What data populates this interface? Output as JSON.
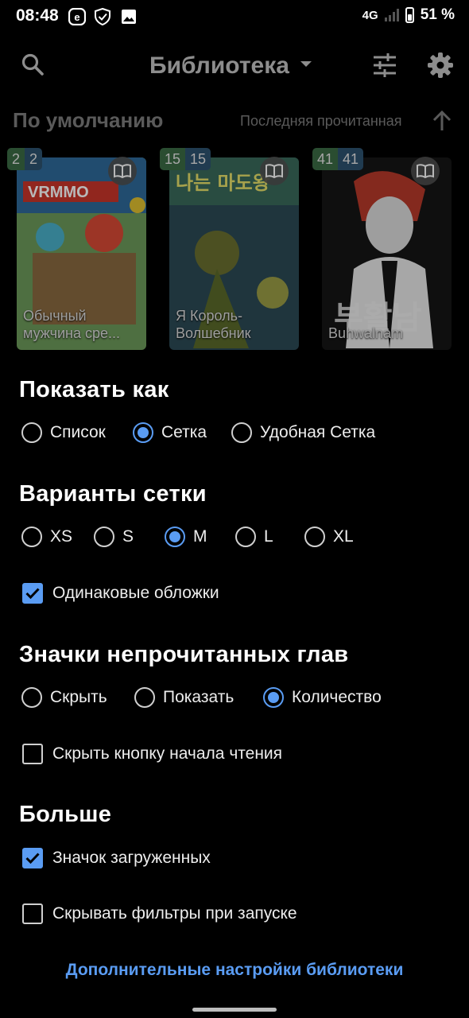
{
  "status_bar": {
    "time": "08:48",
    "network": "4G",
    "battery": "51 %"
  },
  "toolbar": {
    "title": "Библиотека"
  },
  "sort": {
    "group": "По умолчанию",
    "mode": "Последняя прочитанная"
  },
  "library": [
    {
      "title": "Обычный мужчина сре...",
      "unread": "2",
      "downloaded": "2",
      "colors": [
        "#4a7a4a",
        "#c94a3a",
        "#d9b030"
      ]
    },
    {
      "title": "Я Король-Волшебник",
      "unread": "15",
      "downloaded": "15",
      "colors": [
        "#2d4a5a",
        "#6a7a3a",
        "#d9d26a"
      ]
    },
    {
      "title": "Buhwalnam",
      "unread": "41",
      "downloaded": "41",
      "colors": [
        "#1e1e1e",
        "#b83a2a",
        "#f0f0f0"
      ]
    }
  ],
  "display_mode": {
    "title": "Показать как",
    "options": [
      "Список",
      "Сетка",
      "Удобная Сетка"
    ],
    "selected": "Сетка"
  },
  "grid_size": {
    "title": "Варианты сетки",
    "options": [
      "XS",
      "S",
      "M",
      "L",
      "XL"
    ],
    "selected": "M",
    "uniform_covers_label": "Одинаковые обложки",
    "uniform_covers_checked": true
  },
  "unread_badges": {
    "title": "Значки непрочитанных глав",
    "options": [
      "Скрыть",
      "Показать",
      "Количество"
    ],
    "selected": "Количество",
    "hide_start_reading_label": "Скрыть кнопку начала чтения",
    "hide_start_reading_checked": false
  },
  "more": {
    "title": "Больше",
    "download_badge_label": "Значок загруженных",
    "download_badge_checked": true,
    "hide_filters_label": "Скрывать фильтры при запуске",
    "hide_filters_checked": false,
    "advanced_link": "Дополнительные настройки библиотеки"
  },
  "colors": {
    "accent": "#5a9cf3",
    "background": "#000000",
    "dim_text": "#8d8d8d"
  }
}
